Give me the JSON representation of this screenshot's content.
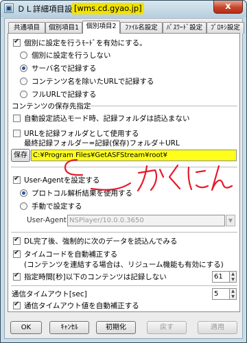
{
  "window": {
    "title": "ＤＬ詳細項目設定",
    "highlight": "[wms.cd.gyao.jp]",
    "close_label": "x"
  },
  "tabs": [
    {
      "label": "共通項目"
    },
    {
      "label": "個別項目1"
    },
    {
      "label": "個別項目2"
    },
    {
      "label": "ﾌｧｲﾙ名設定"
    },
    {
      "label": "ﾊﾟｽﾜｰﾄﾞ設定"
    },
    {
      "label": "ﾌﾟﾛｷｼ設定"
    }
  ],
  "individual": {
    "enable_label": "個別に設定を行うﾓｰﾄﾞを有効にする。",
    "enable_checked": true,
    "radios": [
      {
        "label": "個別に設定を行うしない",
        "selected": false
      },
      {
        "label": "サーバ名で記録する",
        "selected": true
      },
      {
        "label": "コンテンツ名を除いたURLで記録する",
        "selected": false
      },
      {
        "label": "フルURLで記録する",
        "selected": false
      }
    ]
  },
  "save_dest": {
    "header": "コンテンツの保存先指定",
    "auto_label": "自動設定読込モード時、記録フォルダは読込まない",
    "auto_checked": false,
    "url_label": "URLを記録フォルダとして使用する",
    "url_checked": false,
    "note": "最終記録フォルダー=記録(保存)フォルダ＋URL",
    "save_button": "保存",
    "path_value": "C:¥Program Files¥GetASFStream¥root¥"
  },
  "user_agent": {
    "set_label": "User-Agentを設定する",
    "set_checked": true,
    "protocol_label": "プロトコル解析結果を使用する",
    "protocol_selected": true,
    "manual_label": "手動で設定する",
    "manual_selected": false,
    "field_label": "User-Agent:",
    "field_value": "NSPlayer/10.0.0.3650"
  },
  "handwritten_note": "かくにん",
  "options": {
    "dl_complete_label": "DL完了後、強制的に次のデータを読込んでみる",
    "dl_complete_checked": true,
    "timecode_label": "タイムコードを自動補正する",
    "timecode_checked": true,
    "timecode_note": "(コンテンツを連結する場合は、リジューム機能も有効にする)",
    "min_time_label": "指定時間[秒]以下のコンテンツは記録しない",
    "min_time_checked": true,
    "min_time_value": "61",
    "timeout_label": "通信タイムアウト[sec]",
    "timeout_value": "5",
    "timeout_auto_label": "通信タイムアウト値を自動補正する",
    "timeout_auto_checked": true
  },
  "footer": {
    "ok": "OK",
    "cancel": "ｷｬﾝｾﾙ",
    "init": "初期化",
    "back": "戻す",
    "apply": "適用"
  },
  "colors": {
    "title_highlight": "#f2e200",
    "path_highlight": "#ffff1a",
    "annotation_red": "#e8182a",
    "close_red": "#c8442c"
  }
}
